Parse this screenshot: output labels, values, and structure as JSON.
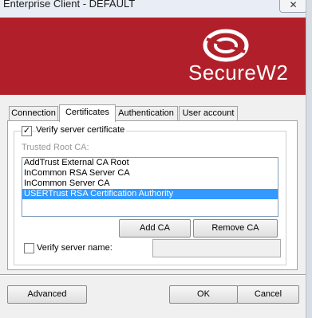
{
  "window": {
    "title": "Enterprise Client - DEFAULT",
    "close_glyph": "✕"
  },
  "banner": {
    "brand_text": "SecureW2",
    "logo_icon": "securew2-logo-icon",
    "color": "#b1202a"
  },
  "tabs": [
    {
      "label": "Connection",
      "active": false
    },
    {
      "label": "Certificates",
      "active": true
    },
    {
      "label": "Authentication",
      "active": false
    },
    {
      "label": "User account",
      "active": false
    }
  ],
  "certificates": {
    "verify_server_certificate": {
      "label": "Verify server certificate",
      "checked": true
    },
    "trusted_root_ca_label": "Trusted Root CA:",
    "ca_list": [
      {
        "name": "AddTrust External CA Root",
        "selected": false
      },
      {
        "name": "InCommon RSA Server CA",
        "selected": false
      },
      {
        "name": "InCommon Server CA",
        "selected": false
      },
      {
        "name": "USERTrust RSA Certification Authority",
        "selected": true
      }
    ],
    "add_ca_label": "Add CA",
    "remove_ca_label": "Remove CA",
    "verify_server_name": {
      "label": "Verify server name:",
      "checked": false,
      "value": ""
    }
  },
  "footer": {
    "advanced_label": "Advanced",
    "ok_label": "OK",
    "cancel_label": "Cancel"
  },
  "colors": {
    "selection": "#3399ff",
    "dialog_bg": "#f0f0f0"
  }
}
